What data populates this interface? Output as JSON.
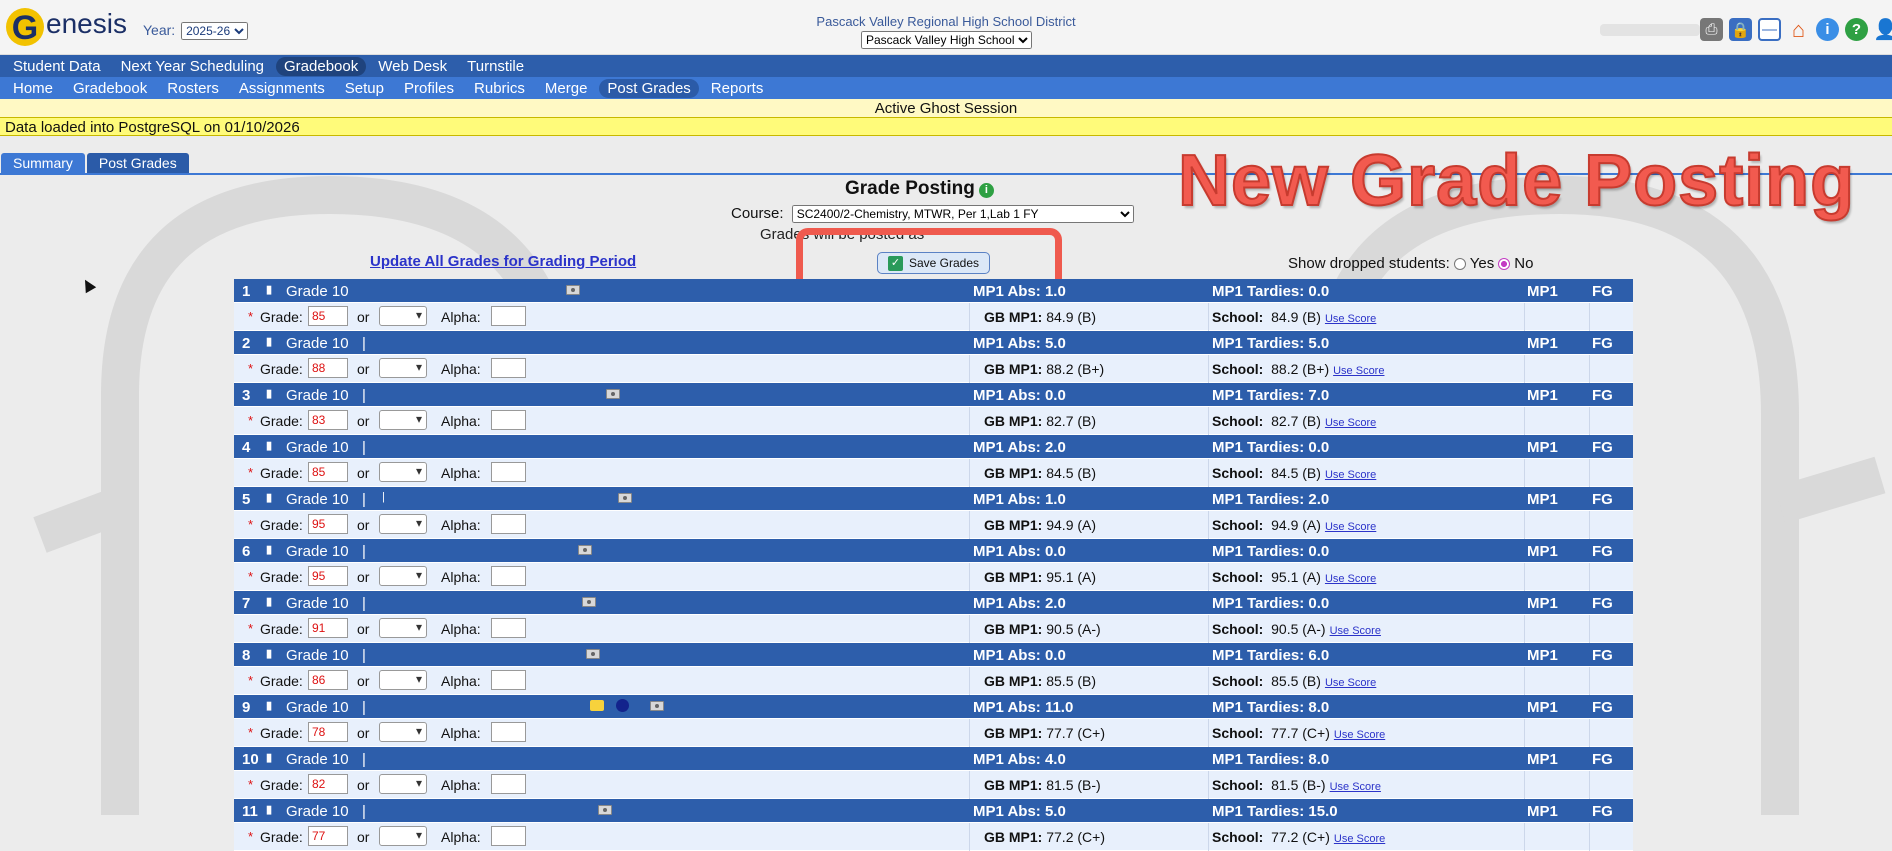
{
  "app": {
    "logo_g": "G",
    "logo_rest": "enesis",
    "year_label": "Year:",
    "year_value": "2025-26",
    "district": "Pascack Valley Regional High School District",
    "school_value": "Pascack Valley High School"
  },
  "nav_primary": [
    "Student Data",
    "Next Year Scheduling",
    "Gradebook",
    "Web Desk",
    "Turnstile"
  ],
  "nav_secondary": [
    "Home",
    "Gradebook",
    "Rosters",
    "Assignments",
    "Setup",
    "Profiles",
    "Rubrics",
    "Merge",
    "Post Grades",
    "Reports"
  ],
  "banners": {
    "ghost": "Active Ghost Session",
    "data": "Data loaded into PostgreSQL on 01/10/2026"
  },
  "tabs": [
    "Summary",
    "Post Grades"
  ],
  "overlay_title": "New Grade Posting",
  "page": {
    "title": "Grade Posting",
    "course_label": "Course:",
    "course_value": "SC2400/2-Chemistry, MTWR, Per 1,Lab 1 FY",
    "posted_as": "Grades will be posted as",
    "update_link": "Update All Grades for Grading Period",
    "save_label": "Save Grades",
    "dropped_label": "Show dropped students:",
    "yes": "Yes",
    "no": "No"
  },
  "labels": {
    "grade": "Grade:",
    "or": "or",
    "alpha": "Alpha:",
    "gb": "GB MP1:",
    "school": "School:",
    "use_score": "Use Score",
    "mp1": "MP1",
    "fg": "FG",
    "grade_level": "Grade 10",
    "bar": "|"
  },
  "students": [
    {
      "num": "1",
      "abs": "MP1 Abs: 1.0",
      "tardies": "MP1 Tardies: 0.0",
      "grade": "85",
      "gb": "84.9 (B)",
      "school": "84.9 (B)"
    },
    {
      "num": "2",
      "abs": "MP1 Abs: 5.0",
      "tardies": "MP1 Tardies: 5.0",
      "grade": "88",
      "gb": "88.2 (B+)",
      "school": "88.2 (B+)"
    },
    {
      "num": "3",
      "abs": "MP1 Abs: 0.0",
      "tardies": "MP1 Tardies: 7.0",
      "grade": "83",
      "gb": "82.7 (B)",
      "school": "82.7 (B)"
    },
    {
      "num": "4",
      "abs": "MP1 Abs: 2.0",
      "tardies": "MP1 Tardies: 0.0",
      "grade": "85",
      "gb": "84.5 (B)",
      "school": "84.5 (B)"
    },
    {
      "num": "5",
      "abs": "MP1 Abs: 1.0",
      "tardies": "MP1 Tardies: 2.0",
      "grade": "95",
      "gb": "94.9 (A)",
      "school": "94.9 (A)"
    },
    {
      "num": "6",
      "abs": "MP1 Abs: 0.0",
      "tardies": "MP1 Tardies: 0.0",
      "grade": "95",
      "gb": "95.1 (A)",
      "school": "95.1 (A)"
    },
    {
      "num": "7",
      "abs": "MP1 Abs: 2.0",
      "tardies": "MP1 Tardies: 0.0",
      "grade": "91",
      "gb": "90.5 (A-)",
      "school": "90.5 (A-)"
    },
    {
      "num": "8",
      "abs": "MP1 Abs: 0.0",
      "tardies": "MP1 Tardies: 6.0",
      "grade": "86",
      "gb": "85.5 (B)",
      "school": "85.5 (B)"
    },
    {
      "num": "9",
      "abs": "MP1 Abs: 11.0",
      "tardies": "MP1 Tardies: 8.0",
      "grade": "78",
      "gb": "77.7 (C+)",
      "school": "77.7 (C+)"
    },
    {
      "num": "10",
      "abs": "MP1 Abs: 4.0",
      "tardies": "MP1 Tardies: 8.0",
      "grade": "82",
      "gb": "81.5 (B-)",
      "school": "81.5 (B-)"
    },
    {
      "num": "11",
      "abs": "MP1 Abs: 5.0",
      "tardies": "MP1 Tardies: 15.0",
      "grade": "77",
      "gb": "77.2 (C+)",
      "school": "77.2 (C+)"
    }
  ],
  "colors": {
    "nav_primary": "#2d5eab",
    "nav_secondary": "#3d78d4",
    "row_head": "#2d5eab",
    "highlight": "#ef5a4e"
  }
}
